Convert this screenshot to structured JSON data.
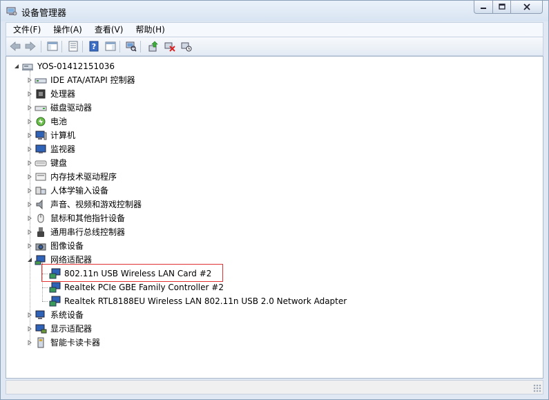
{
  "window": {
    "title": "设备管理器"
  },
  "menu": {
    "items": [
      "文件(F)",
      "操作(A)",
      "查看(V)",
      "帮助(H)"
    ]
  },
  "toolbar": {
    "buttons": [
      "back-arrow-icon",
      "forward-arrow-icon",
      "show-hide-console-tree-icon",
      "properties-icon",
      "help-icon",
      "action-pane-icon",
      "scan-hardware-icon",
      "update-driver-icon",
      "uninstall-device-icon",
      "disable-device-icon"
    ]
  },
  "tree": {
    "root": "YOS-01412151036",
    "categories": [
      {
        "label": "IDE ATA/ATAPI 控制器",
        "icon": "ide-controller-icon"
      },
      {
        "label": "处理器",
        "icon": "processor-icon"
      },
      {
        "label": "磁盘驱动器",
        "icon": "disk-drive-icon"
      },
      {
        "label": "电池",
        "icon": "battery-icon"
      },
      {
        "label": "计算机",
        "icon": "computer-icon"
      },
      {
        "label": "监视器",
        "icon": "monitor-icon"
      },
      {
        "label": "键盘",
        "icon": "keyboard-icon"
      },
      {
        "label": "内存技术驱动程序",
        "icon": "memory-technology-icon"
      },
      {
        "label": "人体学输入设备",
        "icon": "hid-icon"
      },
      {
        "label": "声音、视频和游戏控制器",
        "icon": "sound-icon"
      },
      {
        "label": "鼠标和其他指针设备",
        "icon": "mouse-icon"
      },
      {
        "label": "通用串行总线控制器",
        "icon": "usb-icon"
      },
      {
        "label": "图像设备",
        "icon": "camera-icon"
      },
      {
        "label": "网络适配器",
        "icon": "network-adapter-icon",
        "expanded": true,
        "children": [
          {
            "label": "802.11n USB Wireless LAN Card #2",
            "highlighted": true
          },
          {
            "label": "Realtek PCIe GBE Family Controller #2"
          },
          {
            "label": "Realtek RTL8188EU Wireless LAN 802.11n USB 2.0 Network Adapter"
          }
        ]
      },
      {
        "label": "系统设备",
        "icon": "system-device-icon"
      },
      {
        "label": "显示适配器",
        "icon": "display-adapter-icon"
      },
      {
        "label": "智能卡读卡器",
        "icon": "smart-card-reader-icon"
      }
    ]
  },
  "colors": {
    "highlight_border": "#e03030",
    "titlebar": "#dfe8f3"
  }
}
